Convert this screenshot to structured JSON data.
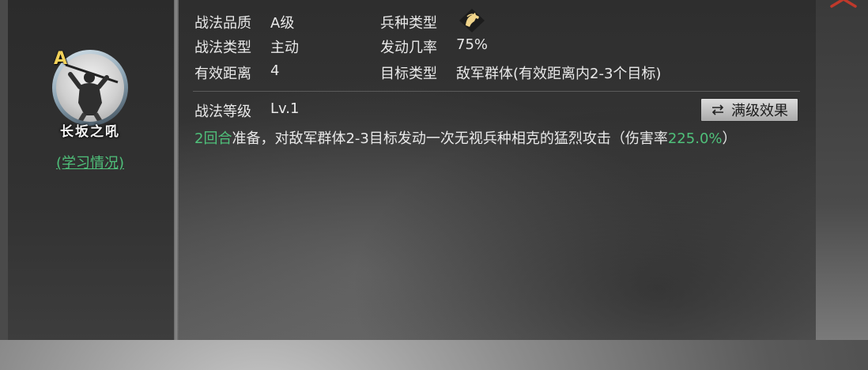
{
  "skill": {
    "grade_badge": "A",
    "name": "长坂之吼",
    "study_link": "(学习情况)"
  },
  "info": {
    "quality_label": "战法品质",
    "quality_value": "A级",
    "troop_type_label": "兵种类型",
    "troop_type_icon": "cavalry-horse-icon",
    "type_label": "战法类型",
    "type_value": "主动",
    "rate_label": "发动几率",
    "rate_value": "75%",
    "range_label": "有效距离",
    "range_value": "4",
    "target_label": "目标类型",
    "target_value": "敌军群体(有效距离内2-3个目标)",
    "level_label": "战法等级",
    "level_value": "Lv.1"
  },
  "max_button": {
    "label": "满级效果",
    "icon": "swap-arrows-icon"
  },
  "description": {
    "prep": "2回合",
    "text1": "准备，对敌军群体2-3目标发动一次无视兵种相克的猛烈攻击（伤害率",
    "rate": "225.0%",
    "text2": "）"
  },
  "colors": {
    "label": "#e2c084",
    "value": "#e9e9e9",
    "highlight_green": "#4fc07a",
    "grade_gold": "#f3d25a"
  }
}
